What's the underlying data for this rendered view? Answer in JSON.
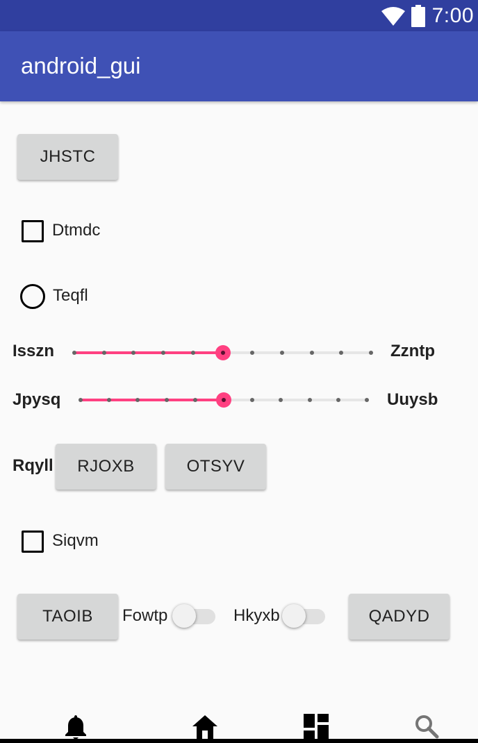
{
  "status_bar": {
    "time": "7:00",
    "wifi_icon": "wifi-icon",
    "battery_icon": "battery-icon"
  },
  "app_bar": {
    "title": "android_gui"
  },
  "content": {
    "button_top": "JHSTC",
    "checkbox1": {
      "label": "Dtmdc",
      "checked": false
    },
    "radio1": {
      "label": "Teqfl",
      "checked": false
    },
    "seekbar1": {
      "left_label": "Isszn",
      "right_label": "Zzntp",
      "value": 5,
      "max": 10
    },
    "seekbar2": {
      "left_label": "Jpysq",
      "right_label": "Uuysb",
      "value": 5,
      "max": 10
    },
    "row_label": "Rqyll",
    "button_rjoxb": "RJOXB",
    "button_otsyv": "OTSYV",
    "checkbox2": {
      "label": "Siqvm",
      "checked": false
    },
    "button_taoib": "TAOIB",
    "switch1": {
      "label": "Fowtp",
      "on": false
    },
    "switch2": {
      "label": "Hkyxb",
      "on": false
    },
    "button_qadyd": "QADYD"
  },
  "bottom_nav": {
    "items": [
      {
        "icon": "bell-icon"
      },
      {
        "icon": "home-icon"
      },
      {
        "icon": "dashboard-icon"
      },
      {
        "icon": "search-icon"
      }
    ]
  },
  "colors": {
    "primary": "#3f51b5",
    "primary_dark": "#303f9f",
    "accent": "#ff4081"
  }
}
